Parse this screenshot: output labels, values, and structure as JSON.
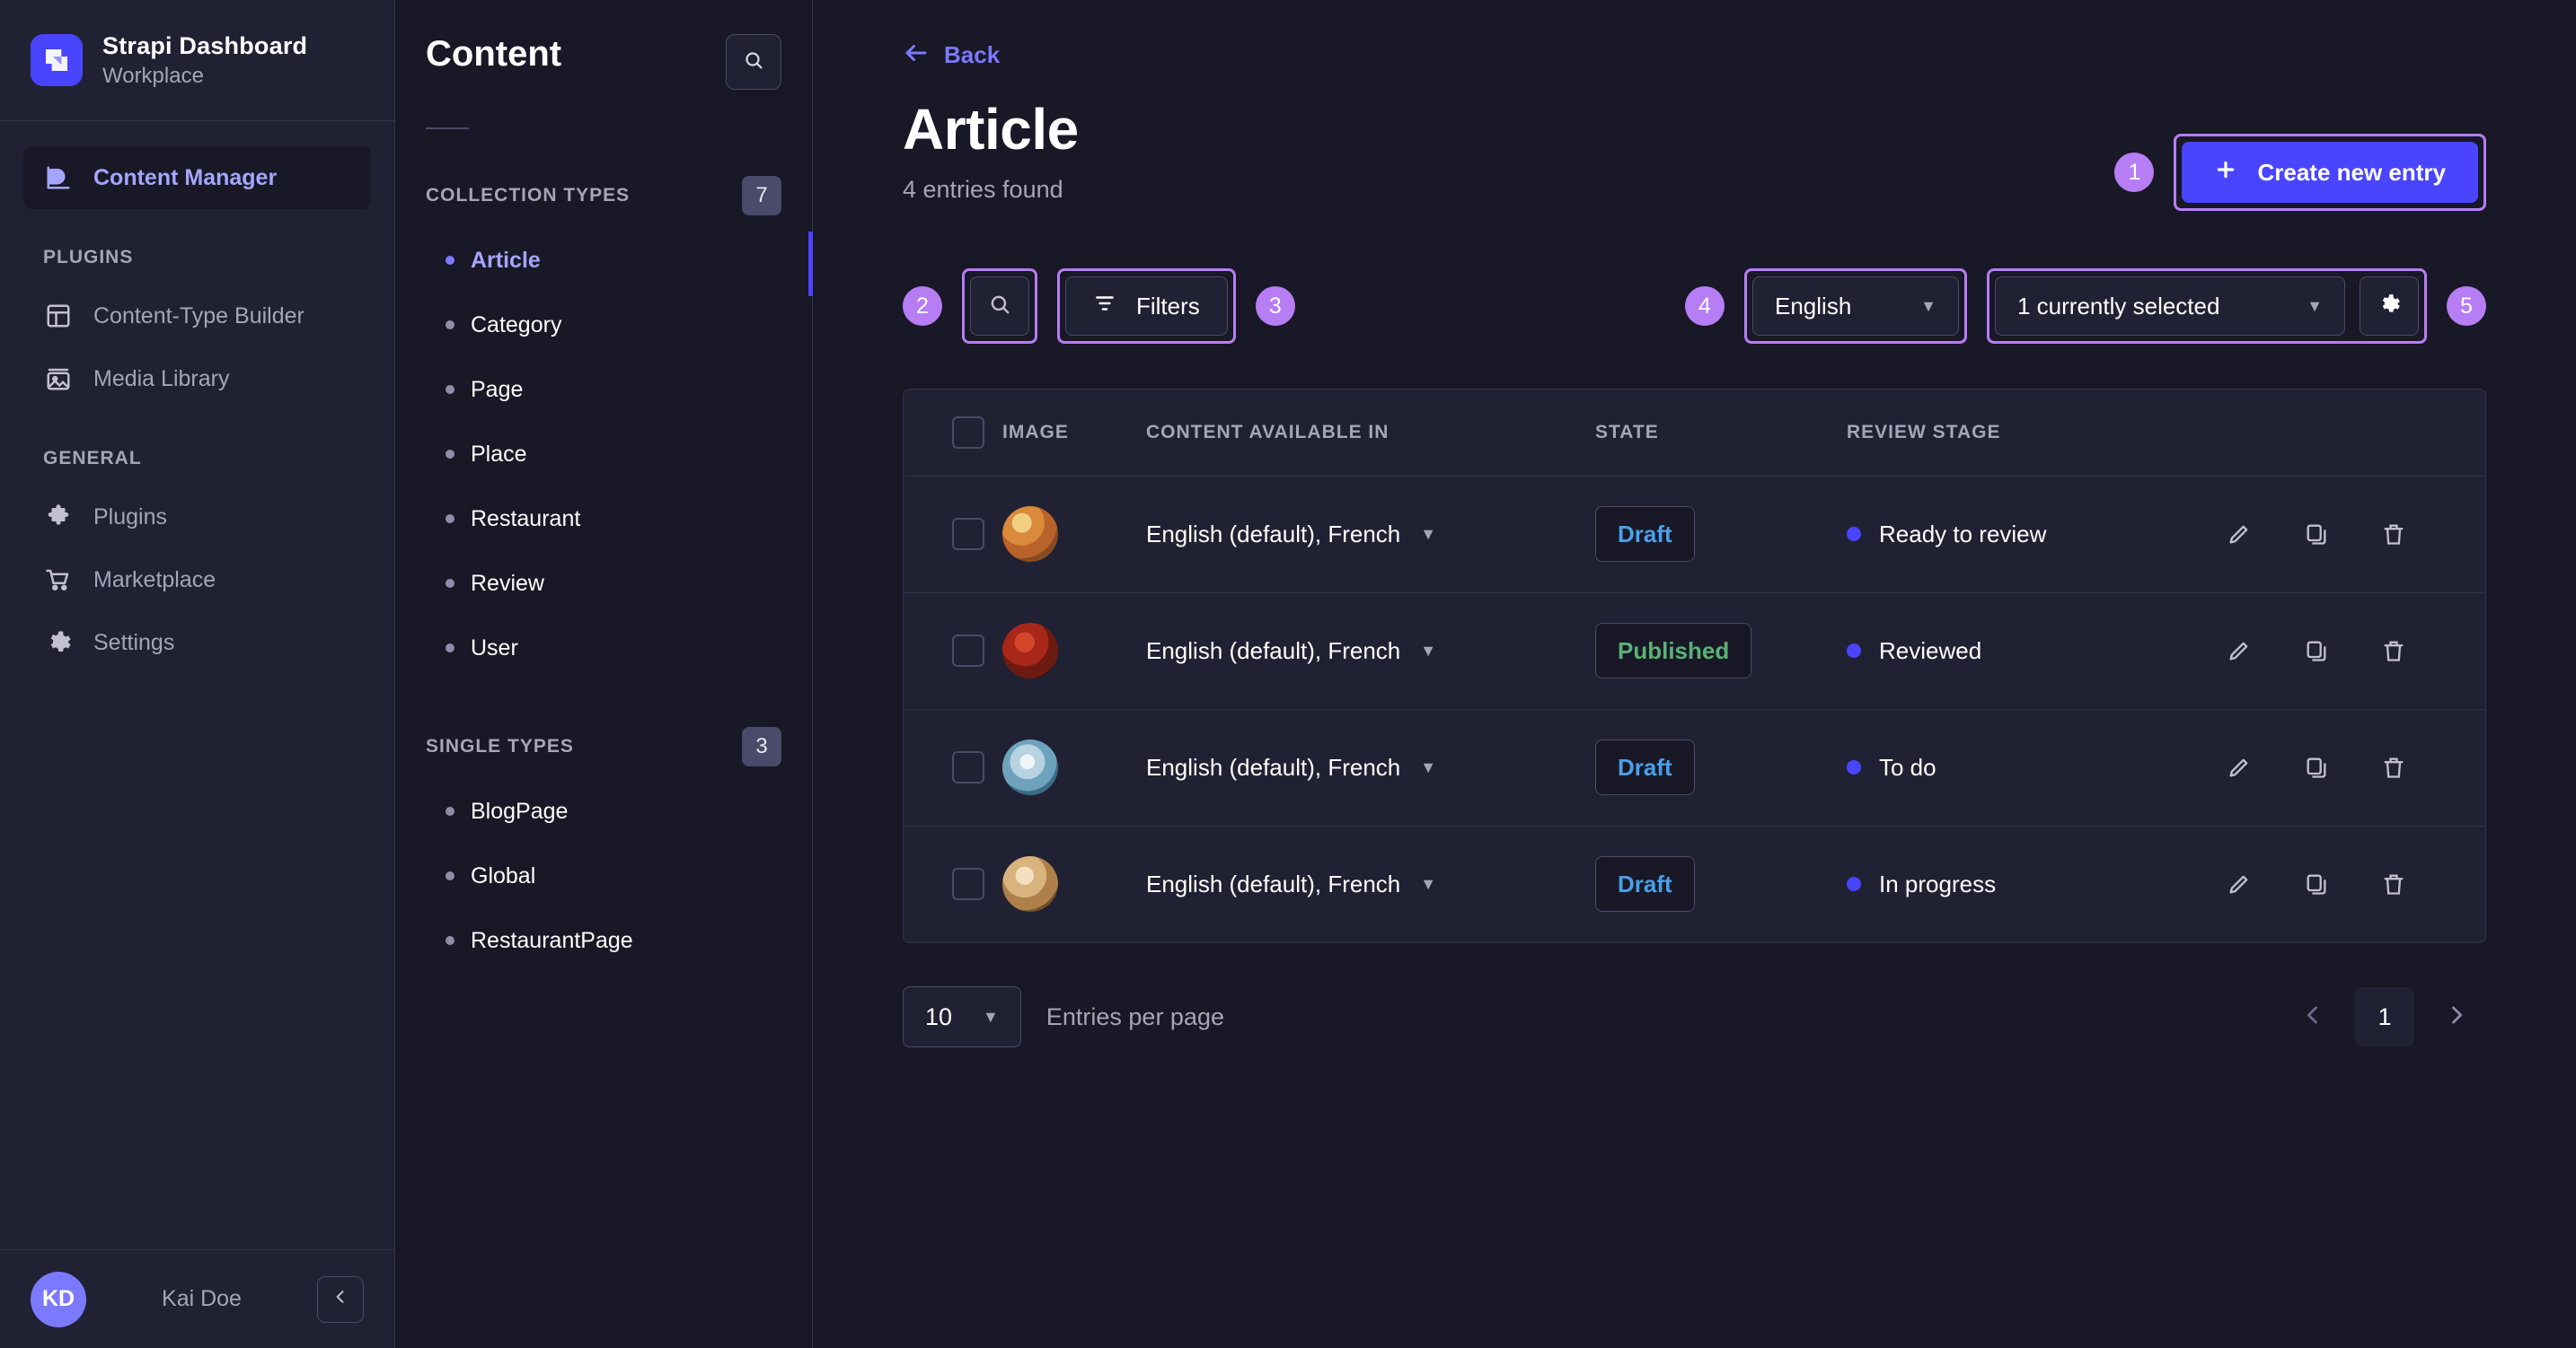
{
  "brand": {
    "title": "Strapi Dashboard",
    "subtitle": "Workplace",
    "logo_icon": "strapi-logo-icon",
    "accent": "#4945ff"
  },
  "sidebar": {
    "primary": {
      "label": "Content Manager",
      "icon": "feather-icon"
    },
    "sections": [
      {
        "title": "PLUGINS",
        "items": [
          {
            "label": "Content-Type Builder",
            "icon": "layout-grid-icon"
          },
          {
            "label": "Media Library",
            "icon": "image-icon"
          }
        ]
      },
      {
        "title": "GENERAL",
        "items": [
          {
            "label": "Plugins",
            "icon": "puzzle-icon"
          },
          {
            "label": "Marketplace",
            "icon": "shopping-cart-icon"
          },
          {
            "label": "Settings",
            "icon": "gear-icon"
          }
        ]
      }
    ],
    "user": {
      "initials": "KD",
      "name": "Kai Doe",
      "collapse_icon": "chevron-left-icon"
    }
  },
  "content_panel": {
    "title": "Content",
    "search_icon": "search-icon",
    "groups": [
      {
        "title": "COLLECTION TYPES",
        "count": "7",
        "items": [
          {
            "label": "Article",
            "active": true
          },
          {
            "label": "Category",
            "active": false
          },
          {
            "label": "Page",
            "active": false
          },
          {
            "label": "Place",
            "active": false
          },
          {
            "label": "Restaurant",
            "active": false
          },
          {
            "label": "Review",
            "active": false
          },
          {
            "label": "User",
            "active": false
          }
        ]
      },
      {
        "title": "SINGLE TYPES",
        "count": "3",
        "items": [
          {
            "label": "BlogPage",
            "active": false
          },
          {
            "label": "Global",
            "active": false
          },
          {
            "label": "RestaurantPage",
            "active": false
          }
        ]
      }
    ]
  },
  "main": {
    "back": {
      "label": "Back",
      "icon": "arrow-left-icon"
    },
    "title": "Article",
    "subtitle": "4 entries found",
    "create_button": {
      "label": "Create new entry",
      "icon": "plus-icon",
      "step": "1",
      "highlight_color": "#b77df5"
    },
    "toolbar": {
      "search": {
        "icon": "search-icon",
        "step": "2"
      },
      "filters": {
        "label": "Filters",
        "icon": "filter-icon",
        "step": "3"
      },
      "locale_select": {
        "value": "English",
        "step": "4",
        "caret_icon": "chevron-down-icon"
      },
      "fields_select": {
        "value": "1 currently selected",
        "caret_icon": "chevron-down-icon"
      },
      "settings": {
        "icon": "gear-icon",
        "step": "5"
      }
    },
    "table": {
      "columns": [
        "IMAGE",
        "CONTENT AVAILABLE IN",
        "STATE",
        "REVIEW STAGE"
      ],
      "select_all_name": "select-all-checkbox",
      "rows": [
        {
          "thumb": "paella-thumbnail",
          "thumb_colors": [
            "#e8b860",
            "#c4722e",
            "#8a4b22"
          ],
          "locales": "English (default), French",
          "state": "Draft",
          "state_type": "draft",
          "review_stage": "Ready to review",
          "review_dot": "#4945ff"
        },
        {
          "thumb": "stew-thumbnail",
          "thumb_colors": [
            "#b8341f",
            "#7a1f12",
            "#40100a"
          ],
          "locales": "English (default), French",
          "state": "Published",
          "state_type": "published",
          "review_stage": "Reviewed",
          "review_dot": "#4945ff"
        },
        {
          "thumb": "salad-bowl-thumbnail",
          "thumb_colors": [
            "#cfe3ef",
            "#6fa3bd",
            "#3c6b86"
          ],
          "locales": "English (default), French",
          "state": "Draft",
          "state_type": "draft",
          "review_stage": "To do",
          "review_dot": "#4945ff"
        },
        {
          "thumb": "pastry-thumbnail",
          "thumb_colors": [
            "#e6cfa8",
            "#b98c55",
            "#6e4e28"
          ],
          "locales": "English (default), French",
          "state": "Draft",
          "state_type": "draft",
          "review_stage": "In progress",
          "review_dot": "#4945ff"
        }
      ],
      "row_actions": [
        {
          "name": "edit-pencil-icon"
        },
        {
          "name": "duplicate-icon"
        },
        {
          "name": "delete-trash-icon"
        }
      ]
    },
    "pagination": {
      "per_page_value": "10",
      "per_page_label": "Entries per page",
      "prev_icon": "chevron-left-icon",
      "next_icon": "chevron-right-icon",
      "current_page": "1"
    }
  }
}
